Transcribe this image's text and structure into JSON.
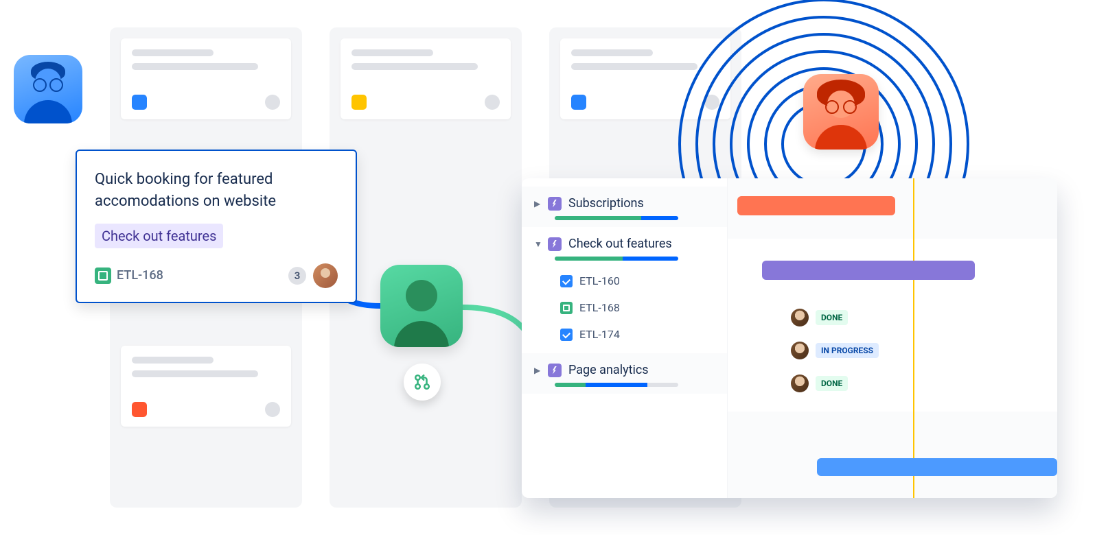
{
  "columns": [
    {
      "cards": [
        {
          "chip_color": "chip-blue"
        },
        {
          "chip_color": "chip-orange"
        }
      ]
    },
    {
      "cards": [
        {
          "chip_color": "chip-yellow"
        }
      ]
    },
    {
      "cards": [
        {
          "chip_color": "chip-blue"
        }
      ]
    }
  ],
  "ticket": {
    "title": "Quick booking for featured accomodations on website",
    "label": "Check out features",
    "key": "ETL-168",
    "count": "3"
  },
  "roadmap": {
    "epics": [
      {
        "name": "Subscriptions",
        "expanded": false,
        "progress": {
          "green": 70,
          "blue": 30
        },
        "bar_color": "#ff7452"
      },
      {
        "name": "Check out features",
        "expanded": true,
        "progress": {
          "green": 55,
          "blue": 45
        },
        "bar_color": "#8777d9",
        "tasks": [
          {
            "key": "ETL-160",
            "type": "task",
            "status": "DONE"
          },
          {
            "key": "ETL-168",
            "type": "story",
            "status": "IN PROGRESS"
          },
          {
            "key": "ETL-174",
            "type": "task",
            "status": "DONE"
          }
        ]
      },
      {
        "name": "Page analytics",
        "expanded": false,
        "progress": {
          "green": 25,
          "blue": 50
        },
        "bar_color": "#4c9aff"
      }
    ]
  },
  "statuses": {
    "done": "DONE",
    "in_progress": "IN PROGRESS"
  }
}
